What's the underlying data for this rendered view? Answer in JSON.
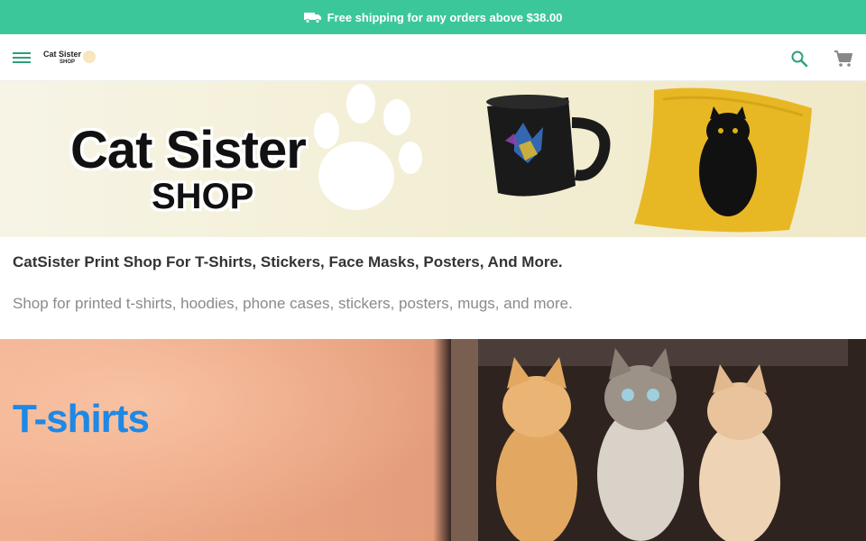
{
  "promo": {
    "text": "Free shipping for any orders above $38.00",
    "icon": "truck-icon",
    "background": "#3cc79b"
  },
  "header": {
    "logo_line1": "Cat Sister",
    "logo_line2": "SHOP",
    "menu_icon": "menu-icon",
    "search_icon": "search-icon",
    "cart_icon": "cart-icon"
  },
  "banner": {
    "title": "Cat Sister",
    "subtitle": "SHOP"
  },
  "intro": {
    "heading": "CatSister Print Shop For T-Shirts, Stickers, Face Masks, Posters, And More.",
    "text": "Shop for printed t-shirts, hoodies, phone cases, stickers, posters, mugs, and more."
  },
  "category": {
    "title": "T-shirts",
    "title_color": "#1e88e5"
  }
}
